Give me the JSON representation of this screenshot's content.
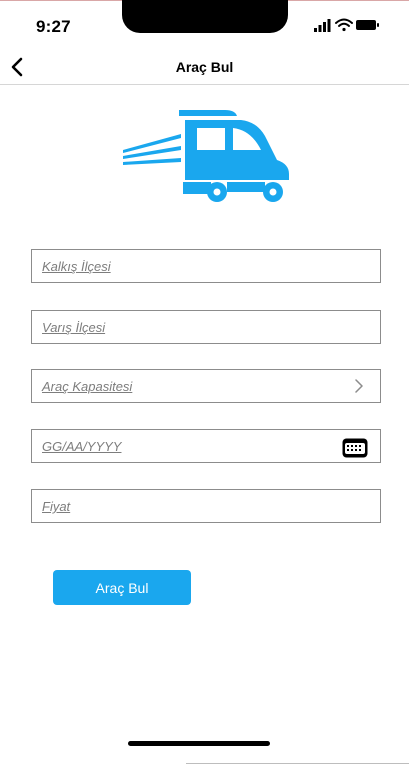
{
  "status_bar": {
    "time": "9:27",
    "icons": [
      "signal-icon",
      "wifi-icon",
      "battery-icon"
    ]
  },
  "nav": {
    "title": "Araç Bul",
    "back_icon": "chevron-left-icon"
  },
  "logo": {
    "icon": "fast-truck-icon",
    "color": "#1aa7ee"
  },
  "form": {
    "departure_district": {
      "placeholder": "Kalkış İlçesi"
    },
    "arrival_district": {
      "placeholder": "Varış İlçesi"
    },
    "vehicle_capacity": {
      "placeholder": "Araç Kapasitesi",
      "icon": "chevron-right-icon"
    },
    "date": {
      "placeholder": "GG/AA/YYYY",
      "icon": "keyboard-icon"
    },
    "price": {
      "placeholder": "Fiyat"
    },
    "submit_label": "Araç Bul"
  },
  "colors": {
    "accent": "#1aa7ee",
    "field_border": "#8c8c8c",
    "placeholder": "#7d7d7d"
  }
}
